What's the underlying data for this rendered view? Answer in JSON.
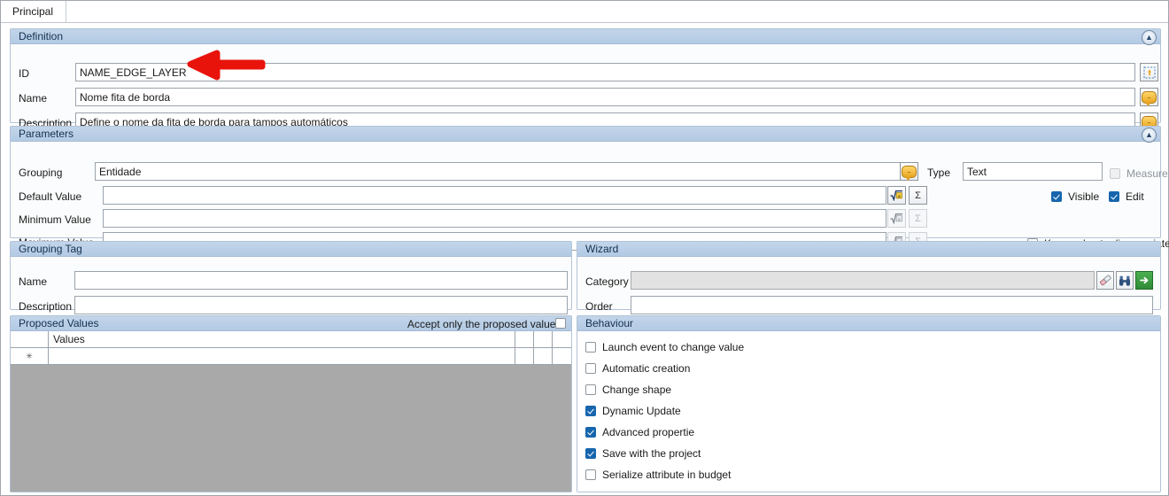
{
  "window": {
    "tab_label": "Principal"
  },
  "definition": {
    "title": "Definition",
    "collapse_icon": "chevron-up-icon",
    "rows": [
      {
        "label": "ID",
        "value": "NAME_EDGE_LAYER",
        "button_icon": "select-entity-icon"
      },
      {
        "label": "Name",
        "value": "Nome fita de borda",
        "button_icon": "translate-icon"
      },
      {
        "label": "Description",
        "value": "Define o nome da fita de borda para tampos automáticos",
        "button_icon": "translate-icon"
      }
    ]
  },
  "parameters": {
    "title": "Parameters",
    "collapse_icon": "chevron-up-icon",
    "grouping": {
      "label": "Grouping",
      "value": "Entidade",
      "translate_icon": "translate-icon"
    },
    "type": {
      "label": "Type",
      "value": "Text"
    },
    "measure": {
      "label": "Measure",
      "checked": false,
      "enabled": false
    },
    "default_value": {
      "label": "Default Value",
      "value": ""
    },
    "minimum_value": {
      "label": "Minimum Value",
      "value": ""
    },
    "maximum_value": {
      "label": "Maximum Value",
      "value": ""
    },
    "formula_icon": "formula-sqrt-a-icon",
    "sum_icon": "sigma-icon",
    "visible": {
      "label": "Visible",
      "checked": true
    },
    "edit": {
      "label": "Edit",
      "checked": true
    },
    "keep_value": {
      "label": "Keep value to disassociate",
      "checked": false
    }
  },
  "grouping_tag": {
    "title": "Grouping Tag",
    "name": {
      "label": "Name",
      "value": ""
    },
    "description": {
      "label": "Description",
      "value": ""
    }
  },
  "wizard": {
    "title": "Wizard",
    "category": {
      "label": "Category",
      "value": ""
    },
    "order": {
      "label": "Order",
      "value": ""
    },
    "buttons": [
      {
        "icon": "eraser-icon"
      },
      {
        "icon": "binoculars-icon"
      },
      {
        "icon": "green-arrow-right-icon"
      }
    ]
  },
  "proposed_values": {
    "title": "Proposed Values",
    "accept_only_label": "Accept only the proposed values",
    "accept_only_checked": false,
    "columns": [
      "",
      "Values",
      "",
      "",
      ""
    ],
    "rows": [
      {
        "marker": "✳",
        "value": ""
      }
    ]
  },
  "behaviour": {
    "title": "Behaviour",
    "items": [
      {
        "label": "Launch event to change value",
        "checked": false
      },
      {
        "label": "Automatic creation",
        "checked": false
      },
      {
        "label": "Change shape",
        "checked": false
      },
      {
        "label": "Dynamic Update",
        "checked": true
      },
      {
        "label": "Advanced propertie",
        "checked": true
      },
      {
        "label": "Save with the project",
        "checked": true
      },
      {
        "label": "Serialize attribute in budget",
        "checked": false
      }
    ]
  },
  "annotation": {
    "type": "red-arrow-left",
    "color": "#e8140c"
  }
}
